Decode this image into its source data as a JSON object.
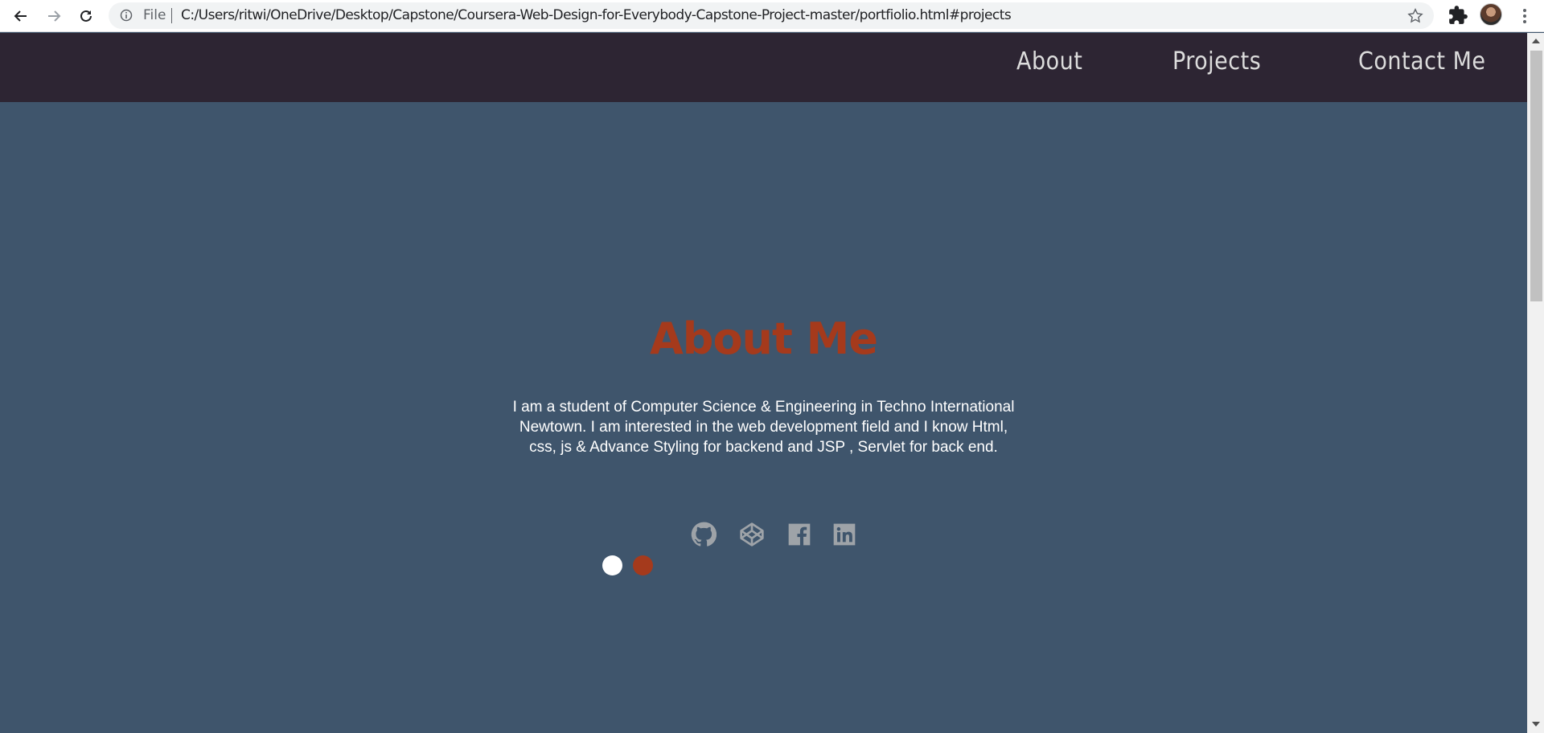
{
  "browser": {
    "file_label": "File",
    "url": "C:/Users/ritwi/OneDrive/Desktop/Capstone/Coursera-Web-Design-for-Everybody-Capstone-Project-master/portfiolio.html#projects"
  },
  "nav": {
    "items": [
      {
        "label": "About"
      },
      {
        "label": "Projects"
      },
      {
        "label": "Contact Me"
      }
    ]
  },
  "about": {
    "title": "About Me",
    "bio": "I am a student of Computer Science & Engineering in Techno International Newtown. I am interested in the web development field and I know Html, css, js & Advance Styling for backend and JSP , Servlet for back end."
  },
  "socials": [
    {
      "icon": "github-icon"
    },
    {
      "icon": "codepen-icon"
    },
    {
      "icon": "facebook-icon"
    },
    {
      "icon": "linkedin-icon"
    }
  ],
  "colors": {
    "nav_bg": "#2d2533",
    "page_bg": "#3f556c",
    "accent": "#a53a1c",
    "icon_gray": "#9ea3a8",
    "dot_white": "#ffffff",
    "dot_accent": "#a53a1c"
  }
}
